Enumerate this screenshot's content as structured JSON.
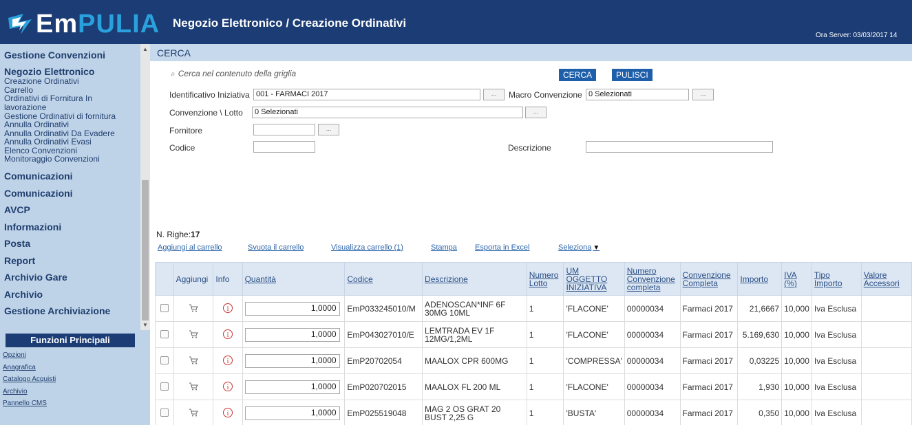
{
  "header": {
    "logo_left": "Em",
    "logo_right": "PULIA",
    "title": "Negozio Elettronico / Creazione Ordinativi",
    "server_time": "Ora Server: 03/03/2017 14"
  },
  "sidebar": {
    "groups_top": [
      {
        "label": "Gestione Convenzioni"
      },
      {
        "label": "Negozio Elettronico"
      }
    ],
    "links": [
      "Creazione Ordinativi",
      "Carrello",
      "Ordinativi di Fornitura In",
      "lavorazione",
      "Gestione Ordinativi di fornitura",
      "Annulla Ordinativi",
      "Annulla Ordinativi Da Evadere",
      "Annulla Ordinativi Evasi",
      "Elenco Convenzioni",
      "Monitoraggio Convenzioni"
    ],
    "groups": [
      "Comunicazioni",
      "Comunicazioni",
      "AVCP",
      "Informazioni",
      "Posta",
      "Report",
      "Archivio Gare",
      "Archivio",
      "Gestione Archiviazione"
    ],
    "funzioni_title": "Funzioni Principali",
    "funzioni_links": [
      "Opzioni",
      "Anagrafica",
      "Catalogo Acquisti",
      "Archivio",
      "Pannello CMS"
    ]
  },
  "search": {
    "section_title": "CERCA",
    "grid_search_placeholder": "Cerca nel contenuto della griglia",
    "cerca_button": "CERCA",
    "pulisci_button": "PULISCI",
    "dots": "...",
    "fields": {
      "identificativo_label": "Identificativo Iniziativa",
      "identificativo_value": "001 - FARMACI 2017",
      "macro_label": "Macro Convenzione",
      "macro_value": "0 Selezionati",
      "convenzione_label": "Convenzione \\ Lotto",
      "convenzione_value": "0 Selezionati",
      "fornitore_label": "Fornitore",
      "fornitore_value": "",
      "codice_label": "Codice",
      "codice_value": "",
      "descrizione_label": "Descrizione",
      "descrizione_value": ""
    }
  },
  "grid_meta": {
    "righe_label": "N. Righe:",
    "righe_count": "17",
    "actions": [
      "Aggiungi al carrello",
      "Svuota il carrello",
      "Visualizza carrello (1)",
      "Stampa",
      "Esporta in Excel",
      "Seleziona"
    ]
  },
  "table": {
    "headers": [
      "",
      "Aggiungi",
      "Info",
      "Quantità",
      "Codice",
      "Descrizione",
      "Numero Lotto",
      "UM OGGETTO INIZIATIVA",
      "Numero Convenzione completa",
      "Convenzione Completa",
      "Importo",
      "IVA (%)",
      "Tipo Importo",
      "Valore Accessori"
    ],
    "rows": [
      {
        "quantita": "1,0000",
        "codice": "EmP033245010/M",
        "descrizione": "ADENOSCAN*INF 6F 30MG 10ML",
        "lotto": "1",
        "um": "'FLACONE'",
        "num_conv": "00000034",
        "conv": "Farmaci 2017",
        "importo": "21,6667",
        "iva": "10,000",
        "tipo": "Iva Esclusa"
      },
      {
        "quantita": "1,0000",
        "codice": "EmP043027010/E",
        "descrizione": "LEMTRADA EV 1F 12MG/1,2ML",
        "lotto": "1",
        "um": "'FLACONE'",
        "num_conv": "00000034",
        "conv": "Farmaci 2017",
        "importo": "5.169,630",
        "iva": "10,000",
        "tipo": "Iva Esclusa"
      },
      {
        "quantita": "1,0000",
        "codice": "EmP20702054",
        "descrizione": "MAALOX CPR 600MG",
        "lotto": "1",
        "um": "'COMPRESSA'",
        "num_conv": "00000034",
        "conv": "Farmaci 2017",
        "importo": "0,03225",
        "iva": "10,000",
        "tipo": "Iva Esclusa"
      },
      {
        "quantita": "1,0000",
        "codice": "EmP020702015",
        "descrizione": "MAALOX FL 200 ML",
        "lotto": "1",
        "um": "'FLACONE'",
        "num_conv": "00000034",
        "conv": "Farmaci 2017",
        "importo": "1,930",
        "iva": "10,000",
        "tipo": "Iva Esclusa"
      },
      {
        "quantita": "1,0000",
        "codice": "EmP025519048",
        "descrizione": "MAG 2 OS GRAT 20 BUST 2,25 G",
        "lotto": "1",
        "um": "'BUSTA'",
        "num_conv": "00000034",
        "conv": "Farmaci 2017",
        "importo": "0,350",
        "iva": "10,000",
        "tipo": "Iva Esclusa"
      }
    ]
  },
  "colors": {
    "header_bg": "#1b3c74",
    "sidebar_bg": "#bfd3e8",
    "accent_blue": "#1f5faa",
    "link_blue": "#2a63a8"
  }
}
